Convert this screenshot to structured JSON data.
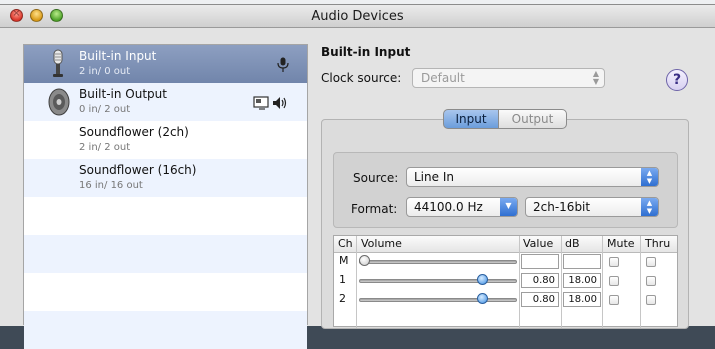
{
  "window": {
    "title": "Audio Devices"
  },
  "devices": [
    {
      "name": "Built-in Input",
      "io": "2 in/ 0 out",
      "icon": "microphone-icon",
      "badge": "microphone-icon",
      "selected": true
    },
    {
      "name": "Built-in Output",
      "io": "0 in/ 2 out",
      "icon": "speaker-icon",
      "badge": "speaker-icon",
      "selected": false
    },
    {
      "name": "Soundflower (2ch)",
      "io": "2 in/ 2 out",
      "selected": false
    },
    {
      "name": "Soundflower (16ch)",
      "io": "16 in/ 16 out",
      "selected": false
    }
  ],
  "detail": {
    "title": "Built-in Input",
    "clock_label": "Clock source:",
    "clock_value": "Default",
    "help": "?"
  },
  "tabs": {
    "input": "Input",
    "output": "Output",
    "active": "Input"
  },
  "source": {
    "label": "Source:",
    "value": "Line In"
  },
  "format": {
    "label": "Format:",
    "rate": "44100.0 Hz",
    "bits": "2ch-16bit"
  },
  "mixer": {
    "headers": {
      "ch": "Ch",
      "volume": "Volume",
      "value": "Value",
      "db": "dB",
      "mute": "Mute",
      "thru": "Thru"
    },
    "rows": [
      {
        "ch": "M",
        "level": 0.0,
        "value": "",
        "db": ""
      },
      {
        "ch": "1",
        "level": 0.8,
        "value": "0.80",
        "db": "18.00"
      },
      {
        "ch": "2",
        "level": 0.8,
        "value": "0.80",
        "db": "18.00"
      }
    ]
  },
  "colors": {
    "selection": "#7a8db2",
    "accent": "#3c8de3"
  }
}
